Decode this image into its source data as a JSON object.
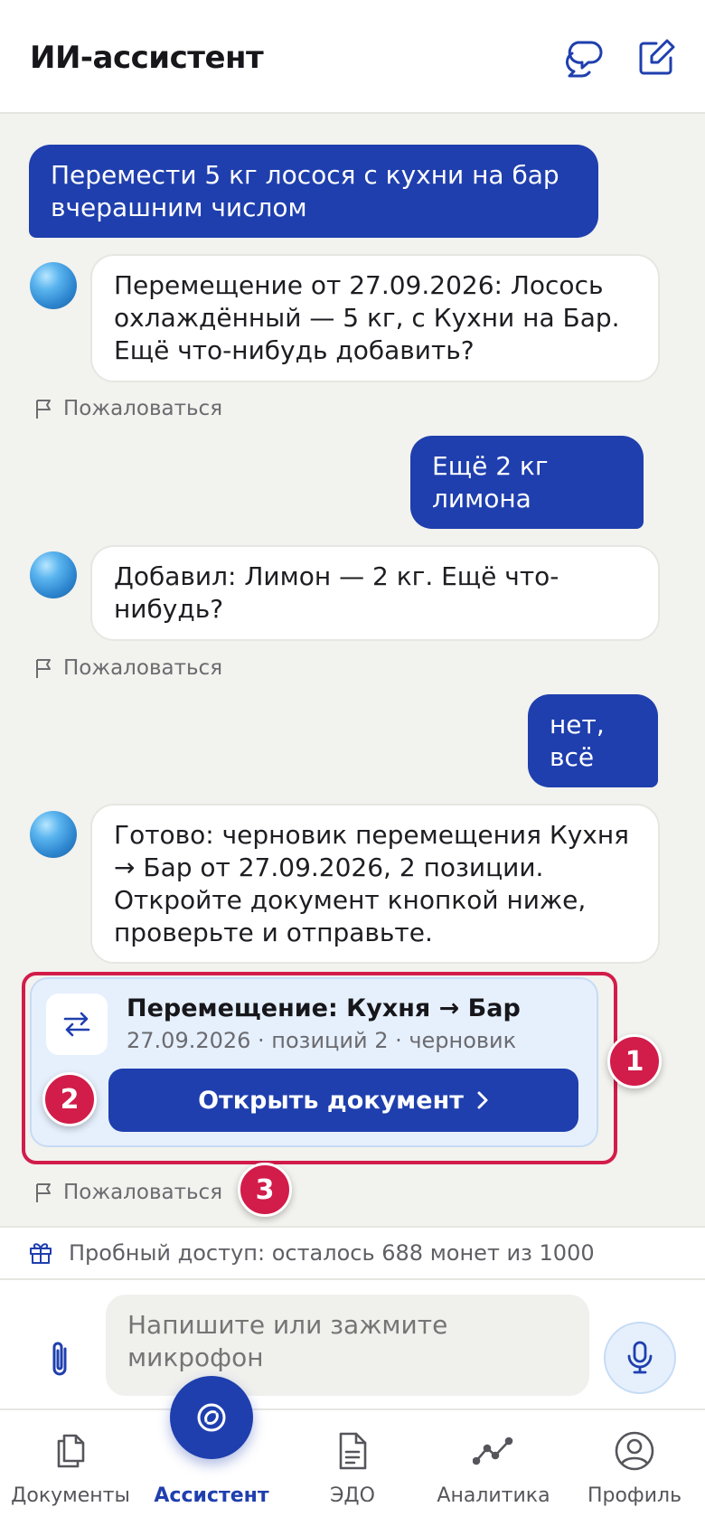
{
  "header": {
    "title": "ИИ-ассистент",
    "chats_icon": "chat-bubbles-icon",
    "new_chat_icon": "edit-icon"
  },
  "messages": [
    {
      "role": "user",
      "text": "Перемести 5 кг лосося с кухни на бар вчерашним числом"
    },
    {
      "role": "assistant",
      "text": "Перемещение от 27.09.2026: Лосось охлаждённый — 5 кг, с Кухни на Бар. Ещё что-нибудь добавить?"
    },
    {
      "role": "user",
      "text": "Ещё 2 кг лимона"
    },
    {
      "role": "assistant",
      "text": "Добавил: Лимон — 2 кг. Ещё что-нибудь?"
    },
    {
      "role": "user",
      "text": "нет, всё"
    },
    {
      "role": "assistant",
      "text": "Готово: черновик перемещения Кухня → Бар от 27.09.2026, 2 позиции. Откройте документ кнопкой ниже, проверьте и отправьте."
    }
  ],
  "report_label": "Пожаловаться",
  "doc_card": {
    "title": "Перемещение: Кухня → Бар",
    "subtitle": "27.09.2026 · позиций 2 · черновик",
    "open_button": "Открыть документ",
    "icon": "transfer-arrows-icon"
  },
  "badges": [
    "1",
    "2",
    "3"
  ],
  "trial": {
    "text": "Пробный доступ: осталось 688 монет из 1000",
    "icon": "gift-icon"
  },
  "composer": {
    "placeholder": "Напишите или зажмите микрофон",
    "attach_icon": "paperclip-icon",
    "mic_icon": "microphone-icon"
  },
  "nav": {
    "items": [
      {
        "label": "Документы",
        "icon": "documents-icon"
      },
      {
        "label": "Ассистент",
        "icon": "assistant-icon",
        "active": true
      },
      {
        "label": "ЭДО",
        "icon": "file-icon"
      },
      {
        "label": "Аналитика",
        "icon": "chart-line-icon"
      },
      {
        "label": "Профиль",
        "icon": "user-icon"
      }
    ]
  },
  "colors": {
    "accent": "#1f3fae",
    "highlight": "#d21c4a",
    "card_bg": "#e6f0fd",
    "background": "#f2f2ee"
  }
}
